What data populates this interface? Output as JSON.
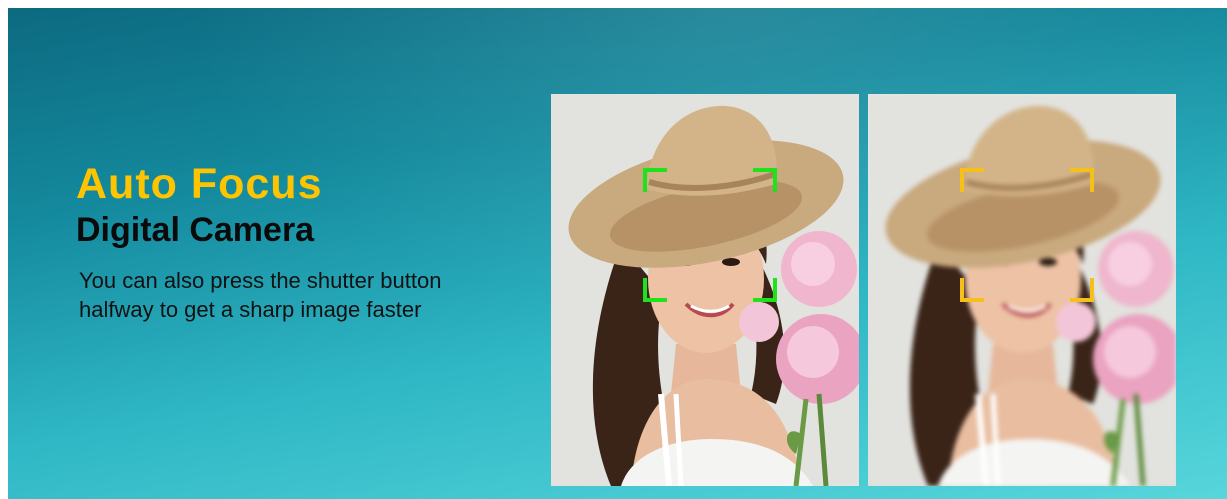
{
  "banner": {
    "title": "Auto Focus",
    "subtitle": "Digital Camera",
    "description_line1": "You can also press the shutter button",
    "description_line2": "halfway to get a sharp image faster"
  },
  "photos": [
    {
      "state": "in-focus",
      "focus_color": "#1fe21a"
    },
    {
      "state": "out-of-focus",
      "focus_color": "#f5c01a"
    }
  ],
  "colors": {
    "title": "#ffc400",
    "background_top": "#0d6a80",
    "background_bottom": "#57d6db"
  }
}
